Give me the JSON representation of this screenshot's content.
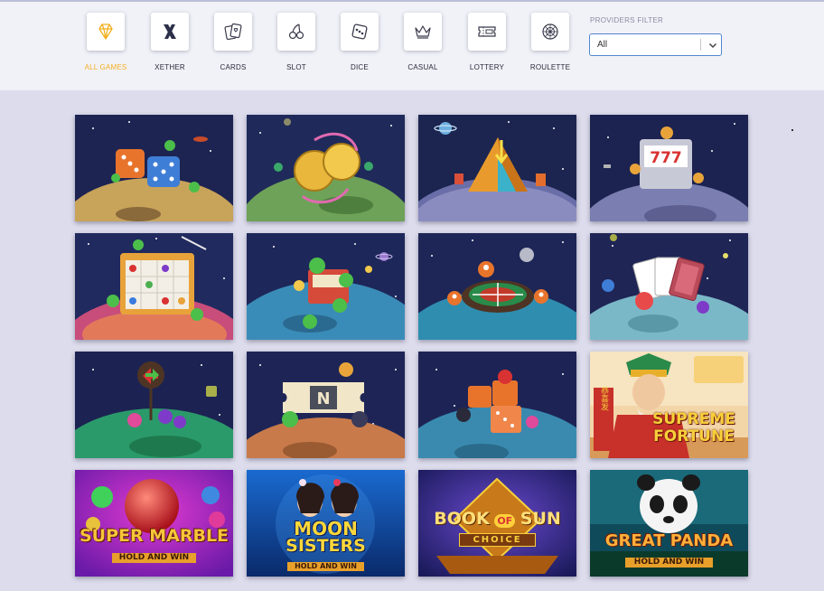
{
  "categories": [
    {
      "label": "ALL GAMES",
      "icon": "diamond-icon",
      "active": true
    },
    {
      "label": "XETHER",
      "icon": "xether-logo-icon",
      "active": false
    },
    {
      "label": "CARDS",
      "icon": "cards-icon",
      "active": false
    },
    {
      "label": "SLOT",
      "icon": "cherry-icon",
      "active": false
    },
    {
      "label": "DICE",
      "icon": "dice-icon",
      "active": false
    },
    {
      "label": "CASUAL",
      "icon": "crown-icon",
      "active": false
    },
    {
      "label": "LOTTERY",
      "icon": "ticket-icon",
      "active": false
    },
    {
      "label": "ROULETTE",
      "icon": "roulette-icon",
      "active": false
    }
  ],
  "providers_filter": {
    "title": "PROVIDERS FILTER",
    "value": "All"
  },
  "colors": {
    "accent": "#f2b01e",
    "select_border": "#4e86cf",
    "header_bg": "#f1f1f8",
    "page_bg": "#dcdcec"
  },
  "games": {
    "supreme_fortune": {
      "line1": "SUPREME",
      "line2": "FORTUNE"
    },
    "super_marble": {
      "line1": "SUPER MARBLE",
      "line2": "HOLD AND WIN"
    },
    "moon_sisters": {
      "line1": "MOON",
      "line2": "SISTERS",
      "line3": "HOLD AND WIN"
    },
    "book_of_sun": {
      "line1": "BOOK",
      "line2": "OF",
      "line3": "SUN",
      "line4": "CHOICE"
    },
    "great_panda": {
      "line1": "GREAT PANDA",
      "line2": "HOLD AND WIN"
    },
    "tile_chars": {
      "slot_digits": "777",
      "ticket_letter": "N",
      "fortune_tag": "恭喜发"
    }
  }
}
